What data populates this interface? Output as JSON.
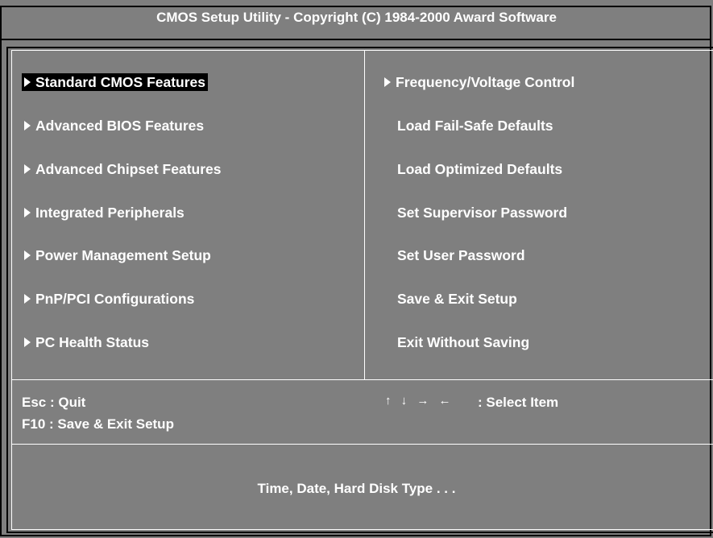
{
  "title": "CMOS Setup Utility - Copyright (C) 1984-2000 Award Software",
  "left_menu": [
    {
      "label": "Standard CMOS Features",
      "has_submenu": true,
      "selected": true
    },
    {
      "label": "Advanced BIOS Features",
      "has_submenu": true
    },
    {
      "label": "Advanced Chipset Features",
      "has_submenu": true
    },
    {
      "label": "Integrated Peripherals",
      "has_submenu": true
    },
    {
      "label": "Power Management Setup",
      "has_submenu": true
    },
    {
      "label": "PnP/PCI Configurations",
      "has_submenu": true
    },
    {
      "label": "PC Health Status",
      "has_submenu": true
    }
  ],
  "right_menu": [
    {
      "label": "Frequency/Voltage Control",
      "has_submenu": true
    },
    {
      "label": "Load Fail-Safe Defaults",
      "has_submenu": false
    },
    {
      "label": "Load Optimized Defaults",
      "has_submenu": false
    },
    {
      "label": "Set Supervisor Password",
      "has_submenu": false
    },
    {
      "label": "Set User Password",
      "has_submenu": false
    },
    {
      "label": "Save & Exit Setup",
      "has_submenu": false
    },
    {
      "label": "Exit Without Saving",
      "has_submenu": false
    }
  ],
  "keys": {
    "esc": "Esc : Quit",
    "f10": "F10 : Save & Exit Setup",
    "nav_arrows": "↑ ↓ → ←",
    "select": ": Select Item"
  },
  "help_text": "Time, Date, Hard Disk Type . . .",
  "colors": {
    "background": "#7f7f7f",
    "text": "#ffffff",
    "highlight": "#000000"
  }
}
